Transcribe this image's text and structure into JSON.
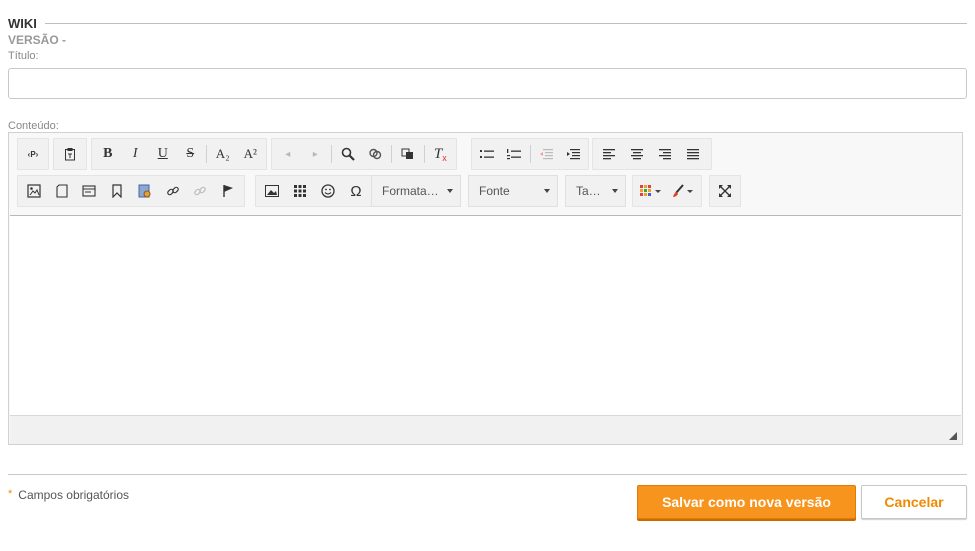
{
  "section": {
    "title": "WIKI",
    "version_label": "VERSÃO -"
  },
  "form": {
    "title_label": "Título:",
    "title_value": "",
    "content_label": "Conteúdo:"
  },
  "editor": {
    "toolbar_icons": [
      "source-icon",
      "paste-text-icon",
      "bold-icon",
      "italic-icon",
      "underline-icon",
      "strike-icon",
      "subscript-icon",
      "superscript-icon",
      "undo-icon",
      "redo-icon",
      "find-icon",
      "replace-icon",
      "select-all-icon",
      "remove-format-icon",
      "bulleted-list-icon",
      "numbered-list-icon",
      "outdent-icon",
      "indent-icon",
      "align-left-icon",
      "align-center-icon",
      "align-right-icon",
      "justify-icon",
      "image-icon",
      "new-page-icon",
      "templates-icon",
      "anchor-icon",
      "media-icon",
      "link-icon",
      "unlink-icon",
      "flag-icon",
      "insert-image-icon",
      "table-icon",
      "smiley-icon",
      "special-char-icon",
      "text-color-icon",
      "background-color-icon",
      "maximize-icon"
    ],
    "glyphs": {
      "source": "‹P›",
      "bold": "B",
      "italic": "I",
      "underline": "U",
      "strike": "S",
      "subscript": "A₂",
      "superscript": "A²",
      "undo": "◂",
      "redo": "▸",
      "remove_format": "T",
      "special_char": "Ω"
    },
    "combos": {
      "format": "Formata…",
      "font": "Fonte",
      "size": "Ta…"
    }
  },
  "footer": {
    "required_marker": "*",
    "required_text": "Campos obrigatórios",
    "save_label": "Salvar como nova versão",
    "cancel_label": "Cancelar"
  },
  "colors": {
    "accent": "#f7941d",
    "accent_text": "#f08a00"
  }
}
